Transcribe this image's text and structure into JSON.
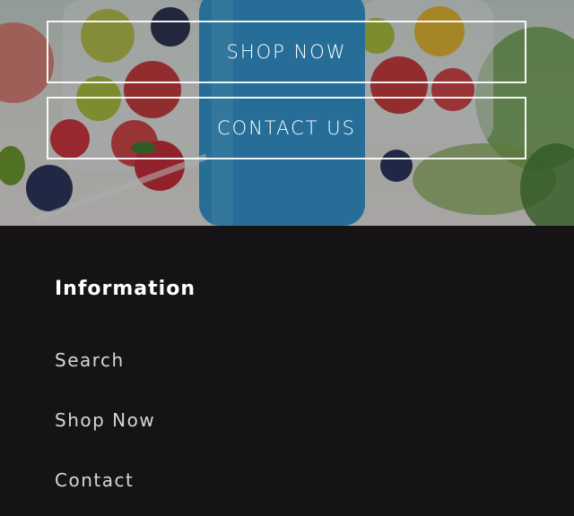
{
  "hero": {
    "shop_now_label": "SHOP NOW",
    "contact_us_label": "CONTACT US"
  },
  "footer": {
    "heading": "Information",
    "links": [
      {
        "label": "Search"
      },
      {
        "label": "Shop Now"
      },
      {
        "label": "Contact"
      }
    ]
  },
  "colors": {
    "footer_background": "#151315",
    "button_border": "#ffffff",
    "cup_blue": "#2f97d2"
  }
}
